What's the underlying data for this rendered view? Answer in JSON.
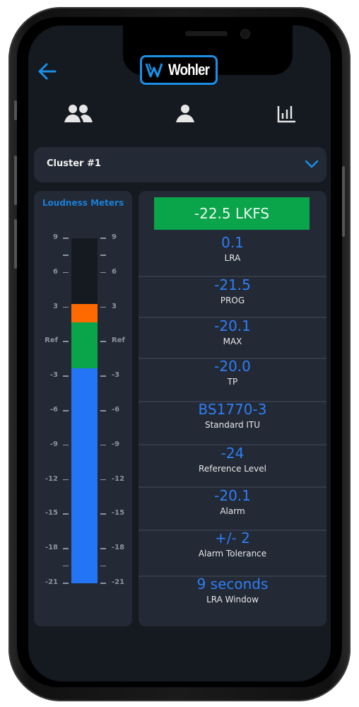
{
  "header": {
    "back_icon": "arrow-left-icon",
    "logo_text": "Wohler"
  },
  "nav": [
    {
      "icon": "users-group-icon",
      "label": "Groups"
    },
    {
      "icon": "user-icon",
      "label": "User"
    },
    {
      "icon": "bar-chart-icon",
      "label": "Meters"
    }
  ],
  "cluster": {
    "selected": "Cluster #1",
    "chevron_icon": "chevron-down-icon"
  },
  "meter": {
    "title": "Loudness Meters",
    "scale_labels": [
      "9",
      "6",
      "3",
      "Ref",
      "-3",
      "-6",
      "-9",
      "-12",
      "-15",
      "-18",
      "-21"
    ],
    "scale_min": -21,
    "scale_max": 9,
    "segments": [
      {
        "name": "blue",
        "from": -21,
        "to": -2.3,
        "color": "#2474f6"
      },
      {
        "name": "green",
        "from": -2.3,
        "to": 1.7,
        "color": "#0aa44a"
      },
      {
        "name": "orange",
        "from": 1.7,
        "to": 3.3,
        "color": "#ff6a00"
      }
    ],
    "colors": {
      "empty": "#151920",
      "tick": "#8c93a0"
    }
  },
  "values": {
    "lkfs": "-22.5 LKFS",
    "rows": [
      {
        "value": "0.1",
        "label": "LRA"
      },
      {
        "value": "-21.5",
        "label": "PROG"
      },
      {
        "value": "-20.1",
        "label": "MAX"
      },
      {
        "value": "-20.0",
        "label": "TP"
      },
      {
        "value": "BS1770-3",
        "label": "Standard ITU"
      },
      {
        "value": "-24",
        "label": "Reference Level"
      },
      {
        "value": "-20.1",
        "label": "Alarm"
      },
      {
        "value": "+/- 2",
        "label": "Alarm Tolerance"
      },
      {
        "value": "9 seconds",
        "label": "LRA Window"
      }
    ]
  },
  "colors": {
    "accent": "#1a8fe6",
    "value_blue": "#2f7ff5",
    "lkfs_green": "#0aa44a",
    "panel": "#232935",
    "background": "#151920"
  }
}
